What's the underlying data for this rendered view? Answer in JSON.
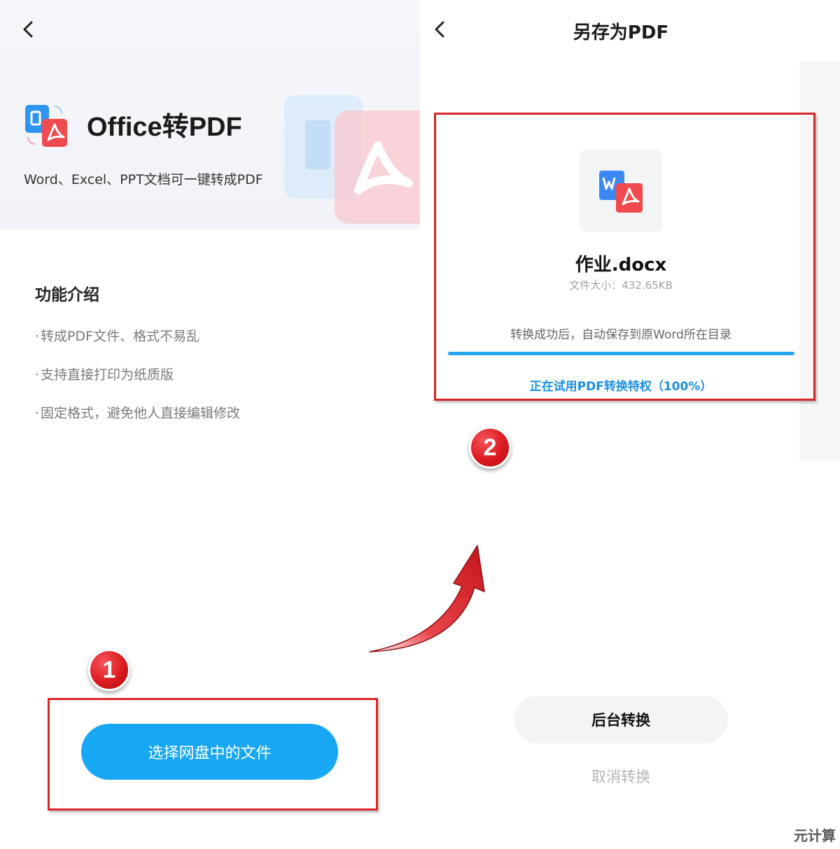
{
  "left_screen": {
    "app_title": "Office转PDF",
    "app_subtitle": "Word、Excel、PPT文档可一键转成PDF",
    "section_title": "功能介绍",
    "features": [
      "转成PDF文件、格式不易乱",
      "支持直接打印为纸质版",
      "固定格式，避免他人直接编辑修改"
    ],
    "primary_button": "选择网盘中的文件"
  },
  "right_screen": {
    "title": "另存为PDF",
    "file_name": "作业.docx",
    "file_size": "文件大小：432.65KB",
    "save_note": "转换成功后，自动保存到原Word所在目录",
    "progress": 1.0,
    "trial_text": "正在试用PDF转换特权（100%）",
    "background_button": "后台转换",
    "cancel_button": "取消转换"
  },
  "annotations": {
    "step1": "1",
    "step2": "2"
  },
  "watermark": "元计算",
  "colors": {
    "accent_blue": "#18a7f3",
    "progress_blue": "#23a6ee",
    "callout_red": "#d9262b",
    "pdf_red": "#f04a4f",
    "word_blue": "#3b87f5"
  },
  "icons": {
    "back": "chevron-left-icon",
    "app_logo": "office-to-pdf-icon",
    "file": "word-to-pdf-icon"
  }
}
